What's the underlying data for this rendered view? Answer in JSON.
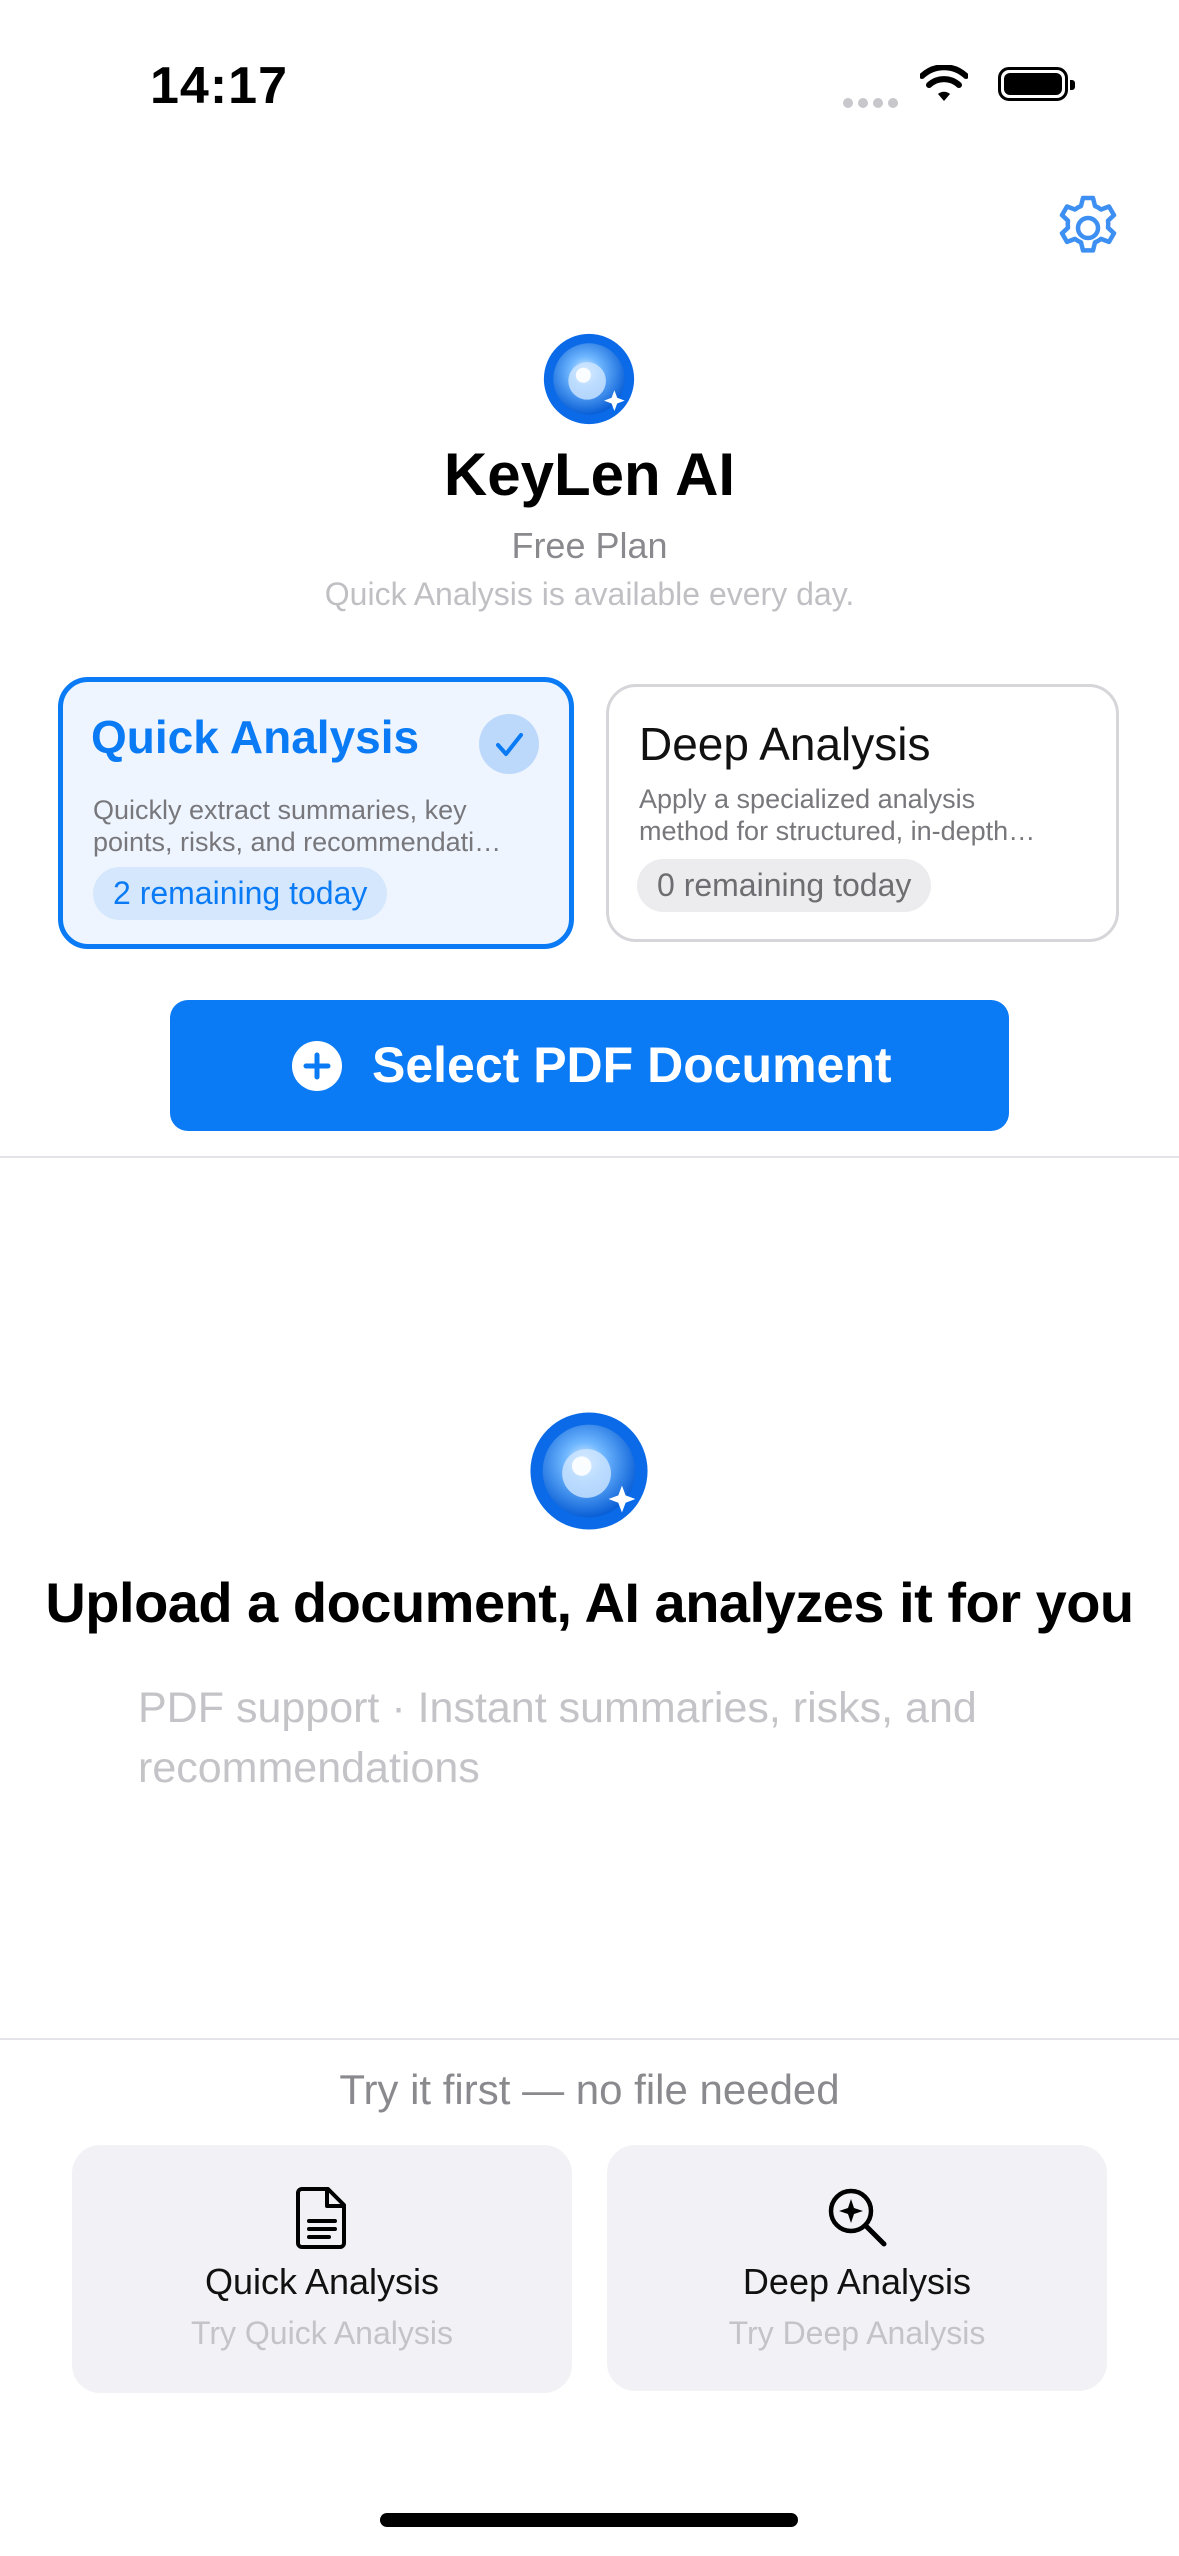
{
  "status_bar": {
    "time": "14:17"
  },
  "header": {
    "app_name": "KeyLen AI",
    "plan": "Free Plan",
    "plan_note": "Quick Analysis is available every day."
  },
  "modes": [
    {
      "title": "Quick Analysis",
      "desc_line1": "Quickly extract summaries, key",
      "desc_line2": "points, risks, and recommendati…",
      "remaining": "2 remaining today",
      "selected": true
    },
    {
      "title": "Deep Analysis",
      "desc_line1": "Apply a specialized analysis",
      "desc_line2": "method for structured, in-depth…",
      "remaining": "0 remaining today",
      "selected": false
    }
  ],
  "cta": {
    "label": "Select PDF Document"
  },
  "empty_state": {
    "headline": "Upload a document, AI analyzes it for you",
    "subtitle": "PDF support · Instant summaries, risks, and recommendations"
  },
  "try_section": {
    "heading": "Try it first — no file needed",
    "tiles": [
      {
        "title": "Quick Analysis",
        "subtitle": "Try Quick Analysis",
        "icon": "document-icon"
      },
      {
        "title": "Deep Analysis",
        "subtitle": "Try Deep Analysis",
        "icon": "magnifier-sparkle-icon"
      }
    ]
  },
  "colors": {
    "accent": "#0A7BF5",
    "muted": "#8A8A8E",
    "tile_bg": "#F2F2F6"
  }
}
